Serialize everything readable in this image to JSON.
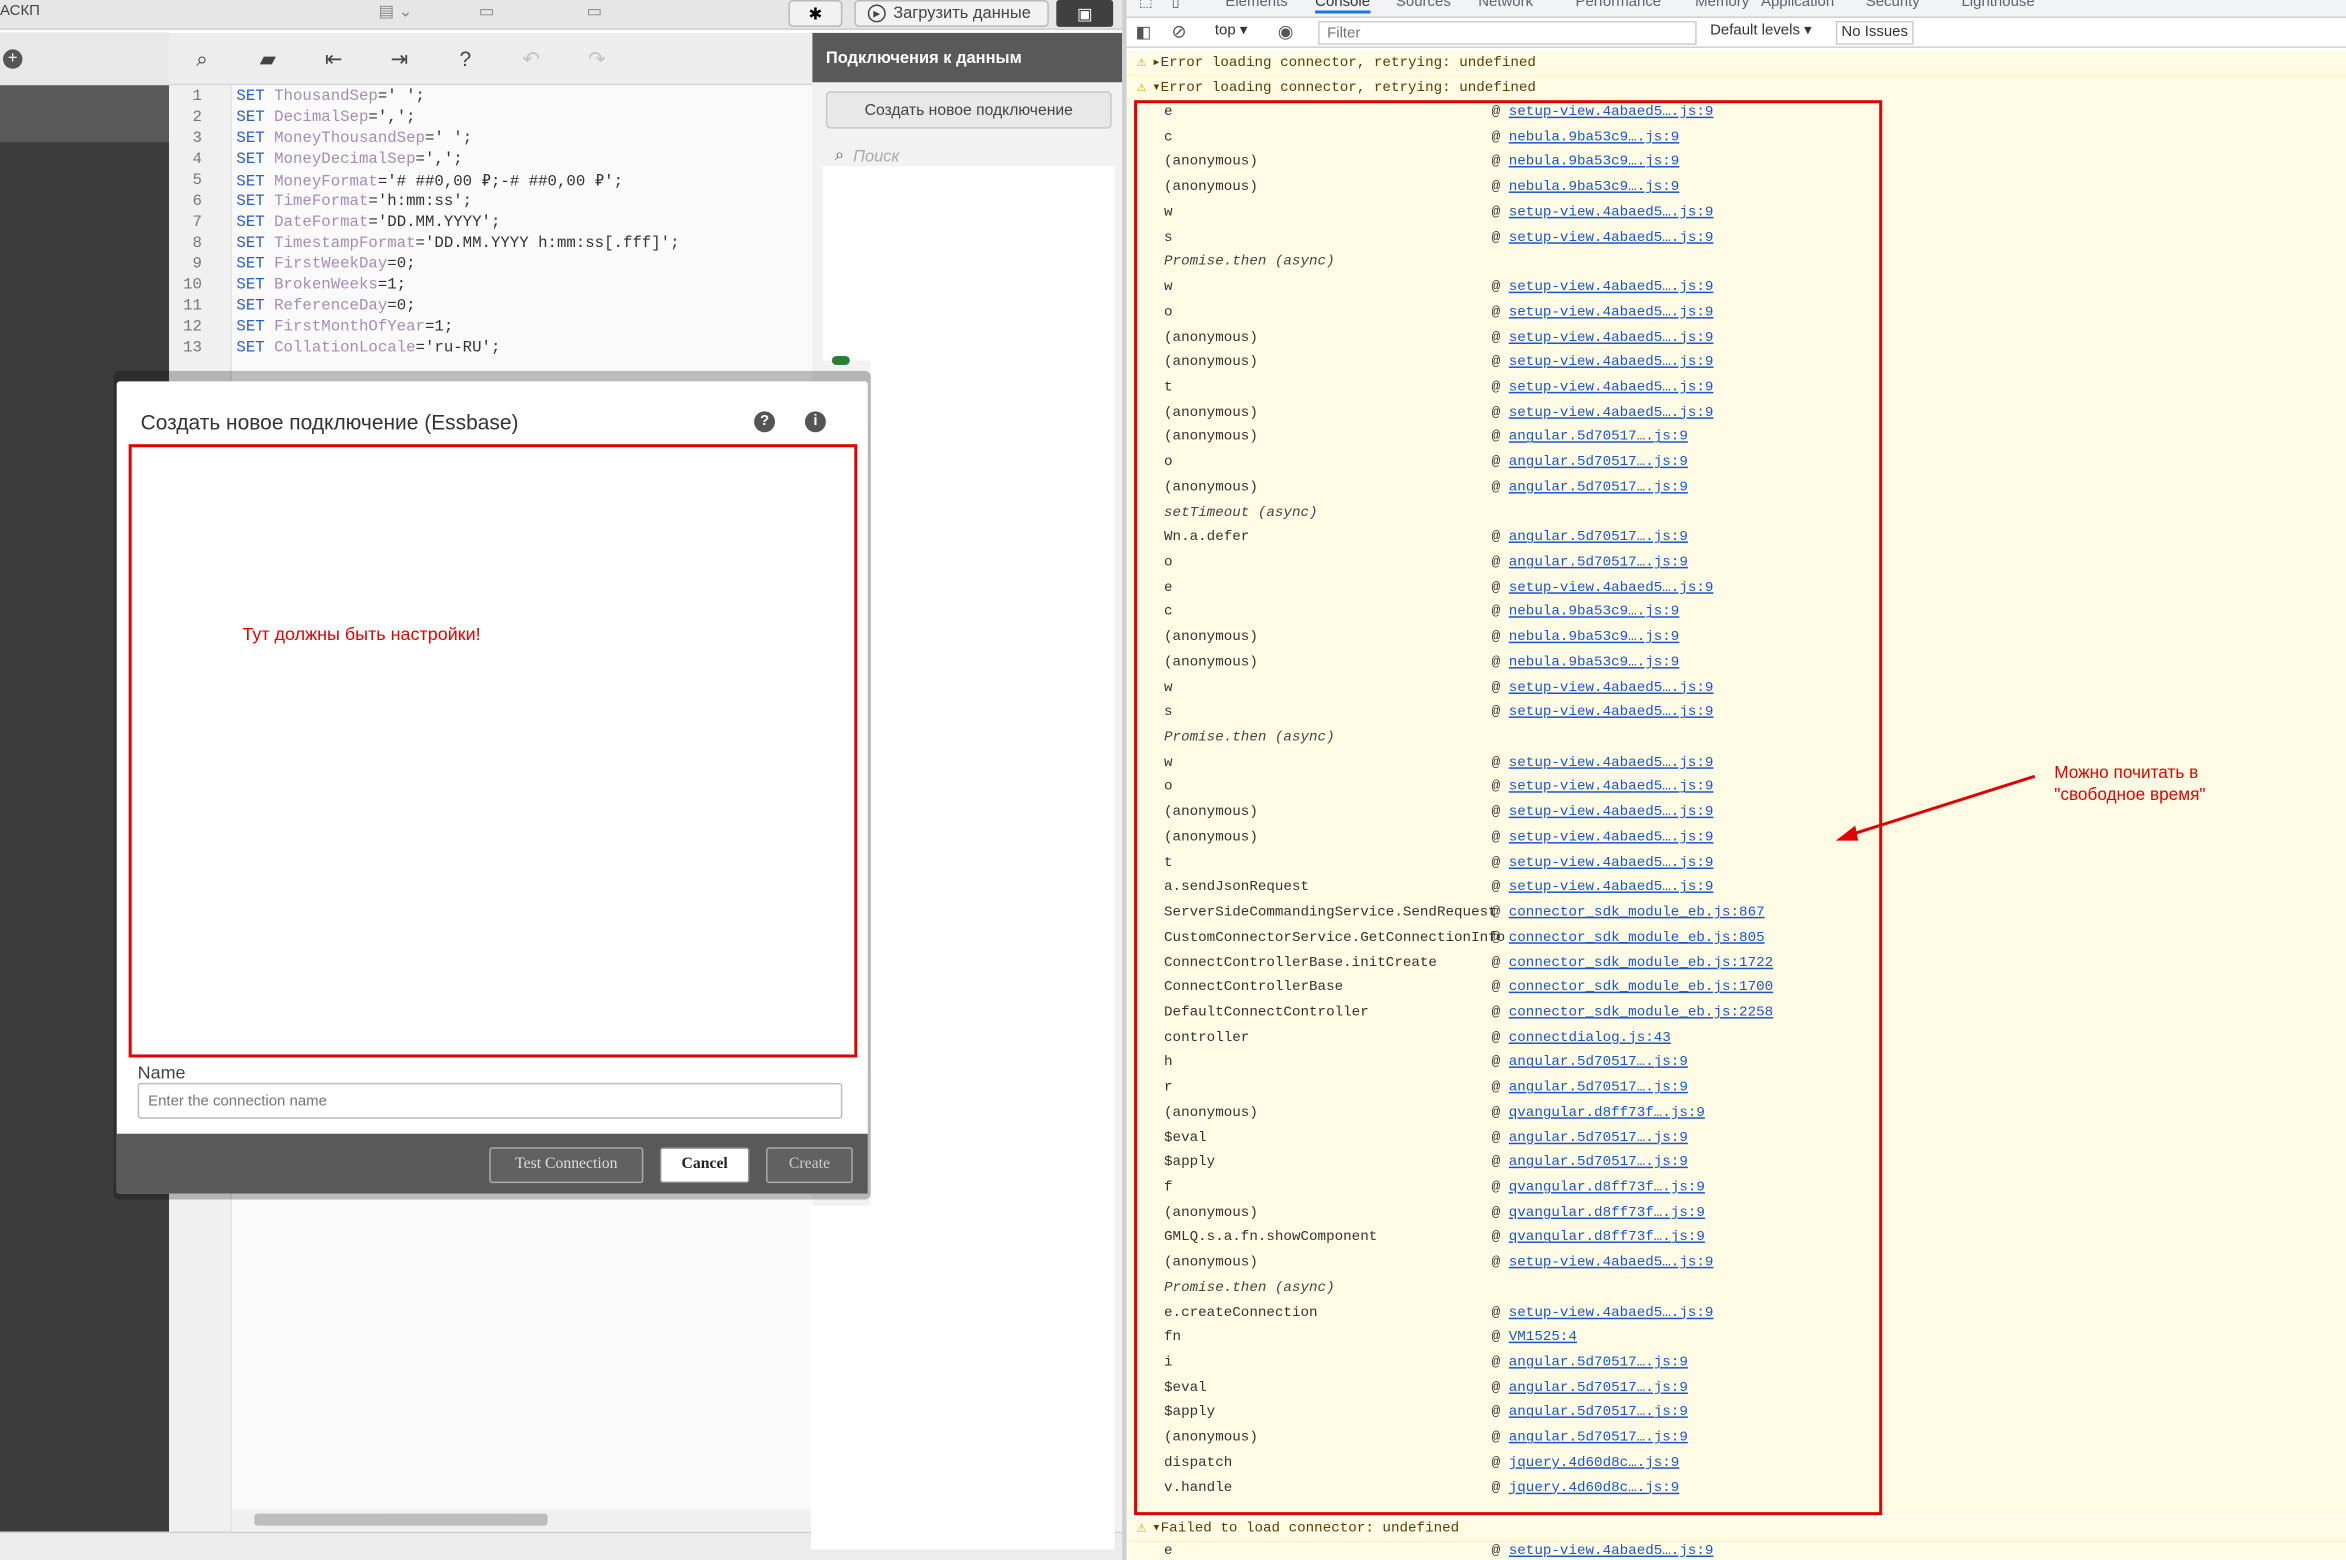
{
  "app": {
    "title": "АСКП",
    "upload_button": "Загрузить данные"
  },
  "editor": {
    "line_numbers": [
      "1",
      "2",
      "3",
      "4",
      "5",
      "6",
      "7",
      "8",
      "9",
      "10",
      "11",
      "12",
      "13"
    ],
    "lines": [
      {
        "kw": "SET",
        "var": "ThousandSep",
        "rest": "=' ';"
      },
      {
        "kw": "SET",
        "var": "DecimalSep",
        "rest": "=',';"
      },
      {
        "kw": "SET",
        "var": "MoneyThousandSep",
        "rest": "=' ';"
      },
      {
        "kw": "SET",
        "var": "MoneyDecimalSep",
        "rest": "=',';"
      },
      {
        "kw": "SET",
        "var": "MoneyFormat",
        "rest": "='# ##0,00 ₽;-# ##0,00 ₽';"
      },
      {
        "kw": "SET",
        "var": "TimeFormat",
        "rest": "='h:mm:ss';"
      },
      {
        "kw": "SET",
        "var": "DateFormat",
        "rest": "='DD.MM.YYYY';"
      },
      {
        "kw": "SET",
        "var": "TimestampFormat",
        "rest": "='DD.MM.YYYY h:mm:ss[.fff]';"
      },
      {
        "kw": "SET",
        "var": "FirstWeekDay",
        "rest": "=0;"
      },
      {
        "kw": "SET",
        "var": "BrokenWeeks",
        "rest": "=1;"
      },
      {
        "kw": "SET",
        "var": "ReferenceDay",
        "rest": "=0;"
      },
      {
        "kw": "SET",
        "var": "FirstMonthOfYear",
        "rest": "=1;"
      },
      {
        "kw": "SET",
        "var": "CollationLocale",
        "rest": "='ru-RU';"
      }
    ]
  },
  "data_panel": {
    "header": "Подключения к данным",
    "create_button": "Создать новое подключение",
    "search_placeholder": "Поиск"
  },
  "dialog": {
    "title": "Создать новое подключение (Essbase)",
    "settings_note": "Тут должны быть настройки!",
    "name_label": "Name",
    "name_placeholder": "Enter the connection name",
    "test_button": "Test Connection",
    "cancel_button": "Cancel",
    "create_button": "Create"
  },
  "devtools": {
    "tabs": [
      "Elements",
      "Console",
      "Sources",
      "Network",
      "Performance",
      "Memory",
      "Application",
      "Security",
      "Lighthouse"
    ],
    "context": "top ▾",
    "filter_placeholder": "Filter",
    "levels": "Default levels ▾",
    "issues": "No Issues",
    "messages": [
      "▸Error loading connector, retrying: undefined",
      "▾Error loading connector, retrying: undefined"
    ],
    "stack": [
      {
        "f": "e",
        "src": "setup-view.4abaed5….js:9"
      },
      {
        "f": "c",
        "src": "nebula.9ba53c9….js:9"
      },
      {
        "f": "(anonymous)",
        "src": "nebula.9ba53c9….js:9"
      },
      {
        "f": "(anonymous)",
        "src": "nebula.9ba53c9….js:9"
      },
      {
        "f": "w",
        "src": "setup-view.4abaed5….js:9"
      },
      {
        "f": "s",
        "src": "setup-view.4abaed5….js:9"
      },
      {
        "f": "Promise.then (async)",
        "src": ""
      },
      {
        "f": "w",
        "src": "setup-view.4abaed5….js:9"
      },
      {
        "f": "o",
        "src": "setup-view.4abaed5….js:9"
      },
      {
        "f": "(anonymous)",
        "src": "setup-view.4abaed5….js:9"
      },
      {
        "f": "(anonymous)",
        "src": "setup-view.4abaed5….js:9"
      },
      {
        "f": "t",
        "src": "setup-view.4abaed5….js:9"
      },
      {
        "f": "(anonymous)",
        "src": "setup-view.4abaed5….js:9"
      },
      {
        "f": "(anonymous)",
        "src": "angular.5d70517….js:9"
      },
      {
        "f": "o",
        "src": "angular.5d70517….js:9"
      },
      {
        "f": "(anonymous)",
        "src": "angular.5d70517….js:9"
      },
      {
        "f": "setTimeout (async)",
        "src": ""
      },
      {
        "f": "Wn.a.defer",
        "src": "angular.5d70517….js:9"
      },
      {
        "f": "o",
        "src": "angular.5d70517….js:9"
      },
      {
        "f": "e",
        "src": "setup-view.4abaed5….js:9"
      },
      {
        "f": "c",
        "src": "nebula.9ba53c9….js:9"
      },
      {
        "f": "(anonymous)",
        "src": "nebula.9ba53c9….js:9"
      },
      {
        "f": "(anonymous)",
        "src": "nebula.9ba53c9….js:9"
      },
      {
        "f": "w",
        "src": "setup-view.4abaed5….js:9"
      },
      {
        "f": "s",
        "src": "setup-view.4abaed5….js:9"
      },
      {
        "f": "Promise.then (async)",
        "src": ""
      },
      {
        "f": "w",
        "src": "setup-view.4abaed5….js:9"
      },
      {
        "f": "o",
        "src": "setup-view.4abaed5….js:9"
      },
      {
        "f": "(anonymous)",
        "src": "setup-view.4abaed5….js:9"
      },
      {
        "f": "(anonymous)",
        "src": "setup-view.4abaed5….js:9"
      },
      {
        "f": "t",
        "src": "setup-view.4abaed5….js:9"
      },
      {
        "f": "a.sendJsonRequest",
        "src": "setup-view.4abaed5….js:9"
      },
      {
        "f": "ServerSideCommandingService.SendRequest",
        "src": "connector_sdk_module_eb.js:867"
      },
      {
        "f": "CustomConnectorService.GetConnectionInfo",
        "src": "connector_sdk_module_eb.js:805"
      },
      {
        "f": "ConnectControllerBase.initCreate",
        "src": "connector_sdk_module_eb.js:1722"
      },
      {
        "f": "ConnectControllerBase",
        "src": "connector_sdk_module_eb.js:1700"
      },
      {
        "f": "DefaultConnectController",
        "src": "connector_sdk_module_eb.js:2258"
      },
      {
        "f": "controller",
        "src": "connectdialog.js:43"
      },
      {
        "f": "h",
        "src": "angular.5d70517….js:9"
      },
      {
        "f": "r",
        "src": "angular.5d70517….js:9"
      },
      {
        "f": "(anonymous)",
        "src": "qvangular.d8ff73f….js:9"
      },
      {
        "f": "$eval",
        "src": "angular.5d70517….js:9"
      },
      {
        "f": "$apply",
        "src": "angular.5d70517….js:9"
      },
      {
        "f": "f",
        "src": "qvangular.d8ff73f….js:9"
      },
      {
        "f": "(anonymous)",
        "src": "qvangular.d8ff73f….js:9"
      },
      {
        "f": "GMLQ.s.a.fn.showComponent",
        "src": "qvangular.d8ff73f….js:9"
      },
      {
        "f": "(anonymous)",
        "src": "setup-view.4abaed5….js:9"
      },
      {
        "f": "Promise.then (async)",
        "src": ""
      },
      {
        "f": "e.createConnection",
        "src": "setup-view.4abaed5….js:9"
      },
      {
        "f": "fn",
        "src": "VM1525:4"
      },
      {
        "f": "i",
        "src": "angular.5d70517….js:9"
      },
      {
        "f": "$eval",
        "src": "angular.5d70517….js:9"
      },
      {
        "f": "$apply",
        "src": "angular.5d70517….js:9"
      },
      {
        "f": "(anonymous)",
        "src": "angular.5d70517….js:9"
      },
      {
        "f": "dispatch",
        "src": "jquery.4d60d8c….js:9"
      },
      {
        "f": "v.handle",
        "src": "jquery.4d60d8c….js:9"
      }
    ],
    "final_message": "▾Failed to load connector: undefined",
    "final_stack": [
      {
        "f": "e",
        "src": "setup-view.4abaed5….js:9"
      }
    ]
  },
  "annotation": {
    "line1": "Можно почитать в",
    "line2": "\"свободное время\""
  },
  "colors": {
    "accent_red": "#e00000",
    "link": "#1a55c9",
    "warning_bg": "#fffbe5"
  }
}
